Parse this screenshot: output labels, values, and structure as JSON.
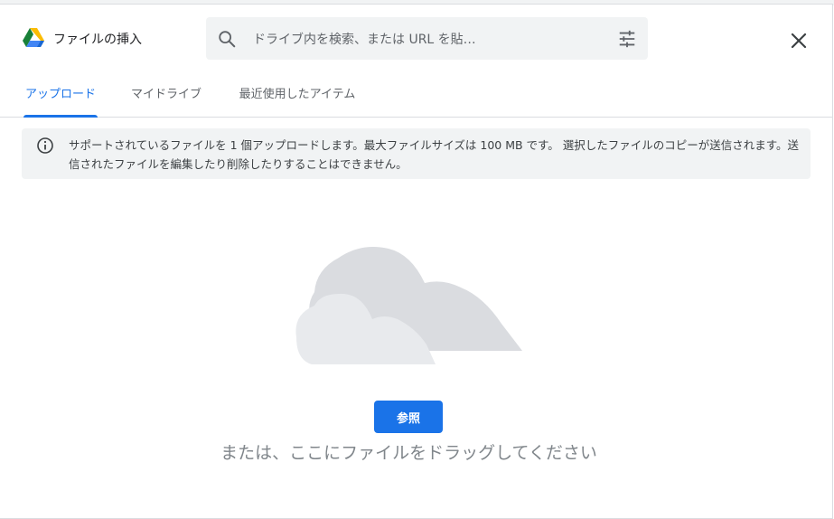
{
  "dialog": {
    "title": "ファイルの挿入",
    "close_label": "close"
  },
  "search": {
    "placeholder": "ドライブ内を検索、または URL を貼…",
    "value": ""
  },
  "tabs": [
    {
      "label": "アップロード",
      "active": true
    },
    {
      "label": "マイドライブ",
      "active": false
    },
    {
      "label": "最近使用したアイテム",
      "active": false
    }
  ],
  "info": {
    "text": "サポートされているファイルを 1 個アップロードします。最大ファイルサイズは 100 MB です。 選択したファイルのコピーが送信されます。送信されたファイルを編集したり削除したりすることはできません。"
  },
  "upload": {
    "browse_label": "参照",
    "drag_hint": "または、ここにファイルをドラッグしてください"
  },
  "icons": {
    "logo": "google-drive-icon",
    "search": "search-icon",
    "filter": "tune-icon",
    "close": "close-icon",
    "info": "info-icon",
    "illustration": "cloud-illustration"
  },
  "colors": {
    "accent": "#1a73e8",
    "banner_bg": "#f1f3f4",
    "cloud_dark": "#dadce0",
    "cloud_light": "#e8eaed"
  }
}
